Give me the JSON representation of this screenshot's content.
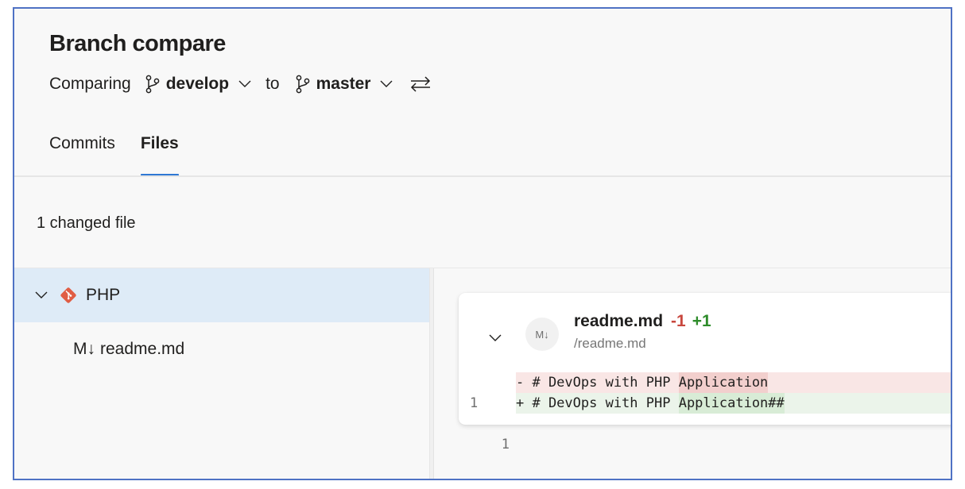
{
  "header": {
    "title": "Branch compare",
    "comparing_label": "Comparing",
    "source_branch": "develop",
    "to_label": "to",
    "target_branch": "master",
    "swap_icon": "swap-arrows-icon",
    "branch_icon": "git-branch-icon"
  },
  "tabs": [
    {
      "label": "Commits",
      "active": false
    },
    {
      "label": "Files",
      "active": true
    }
  ],
  "summary": "1 changed file",
  "tree": {
    "folder": {
      "name": "PHP",
      "icon": "git-repo-icon",
      "expanded": true,
      "selected": true
    },
    "files": [
      {
        "icon_glyph": "M↓",
        "name": "readme.md"
      }
    ]
  },
  "diff_card": {
    "avatar_glyph": "M↓",
    "file_name": "readme.md",
    "removed": "-1",
    "added": "+1",
    "file_path": "/readme.md",
    "lines": [
      {
        "type": "del",
        "old": "1",
        "new": "",
        "prefix": "- # DevOps with PHP ",
        "highlight": "Application",
        "suffix": ""
      },
      {
        "type": "add",
        "old": "",
        "new": "1",
        "prefix": "+ # DevOps with PHP ",
        "highlight": "Application##",
        "suffix": ""
      }
    ]
  },
  "colors": {
    "accent": "#2f78d4",
    "frame_border": "#4f72c4",
    "selected_row": "#deebf7",
    "removed": "#c8473e",
    "added": "#2e8c2b",
    "repo_icon": "#e05d44"
  }
}
